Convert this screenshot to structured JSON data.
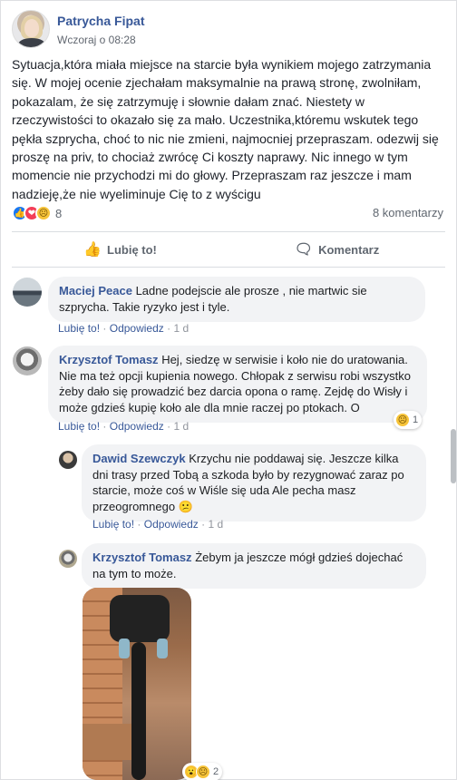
{
  "post": {
    "author": "Patrycha Fipat",
    "time": "Wczoraj o 08:28",
    "text": "Sytuacja,która miała miejsce na starcie była wynikiem mojego zatrzymania się. W mojej ocenie zjechałam maksymalnie na prawą stronę, zwolniłam, pokazalam, że się zatrzymuję i słownie dałam znać. Niestety w rzeczywistości to okazało się za mało. Uczestnika,któremu wskutek tego pękła szprycha, choć to nic nie zmieni, najmocniej przepraszam. odezwij się proszę na priv, to chociaż zwrócę Ci koszty naprawy. Nic innego w tym momencie nie przychodzi mi do głowy. Przepraszam raz jeszcze i mam nadzieję,że nie wyeliminuje Cię to z wyścigu",
    "reaction_count": "8",
    "comments_count": "8 komentarzy",
    "like_label": "Lubię to!",
    "comment_label": "Komentarz",
    "icons": {
      "like": "thumbs-up-icon",
      "love": "heart-icon",
      "sad": "sad-face-icon",
      "comment": "speech-bubble-icon",
      "more": "more-dots-icon"
    }
  },
  "comments": [
    {
      "name": "Maciej Peace",
      "text": "Ladne podejscie ale prosze , nie martwic sie szprycha. Takie ryzyko jest i tyle.",
      "like": "Lubię to!",
      "reply": "Odpowiedz",
      "time": "1 d"
    },
    {
      "name": "Krzysztof Tomasz",
      "text": "Hej, siedzę w serwisie i koło nie do uratowania. Nie ma też opcji kupienia nowego. Chłopak z serwisu robi wszystko żeby dało się prowadzić bez darcia opona o ramę. Zejdę do Wisły i może gdzieś kupię koło ale dla mnie raczej po ptokach. O",
      "like": "Lubię to!",
      "reply": "Odpowiedz",
      "time": "1 d",
      "reaction_count": "1"
    },
    {
      "name": "Dawid Szewczyk",
      "text": "Krzychu nie poddawaj się. Jeszcze kilka dni trasy przed Tobą a szkoda było by rezygnować zaraz po starcie, może coś w Wiśle się uda Ale pecha masz przeogromnego 😕",
      "like": "Lubię to!",
      "reply": "Odpowiedz",
      "time": "1 d"
    },
    {
      "name": "Krzysztof Tomasz",
      "text": "Żebym ja jeszcze mógł gdzieś dojechać na tym to może.",
      "reaction_count": "2"
    }
  ]
}
